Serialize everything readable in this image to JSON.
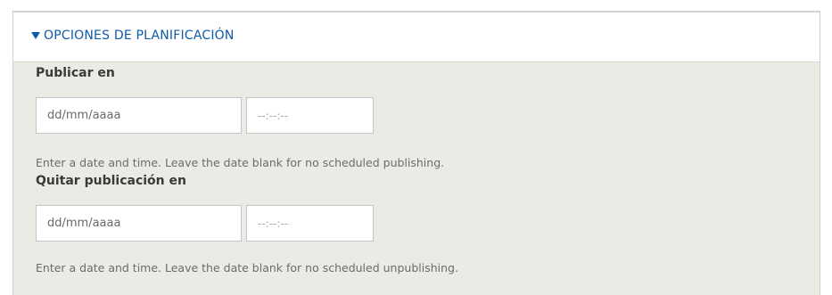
{
  "section": {
    "title": "OPCIONES DE PLANIFICACIÓN",
    "toggle_icon": "triangle-down-icon",
    "accent_color": "#0e5ba8"
  },
  "publish": {
    "label": "Publicar en",
    "date_placeholder": "dd/mm/aaaa",
    "time_placeholder": "--:--:--",
    "help": "Enter a date and time. Leave the date blank for no scheduled publishing."
  },
  "unpublish": {
    "label": "Quitar publicación en",
    "date_placeholder": "dd/mm/aaaa",
    "time_placeholder": "--:--:--",
    "help": "Enter a date and time. Leave the date blank for no scheduled unpublishing."
  }
}
